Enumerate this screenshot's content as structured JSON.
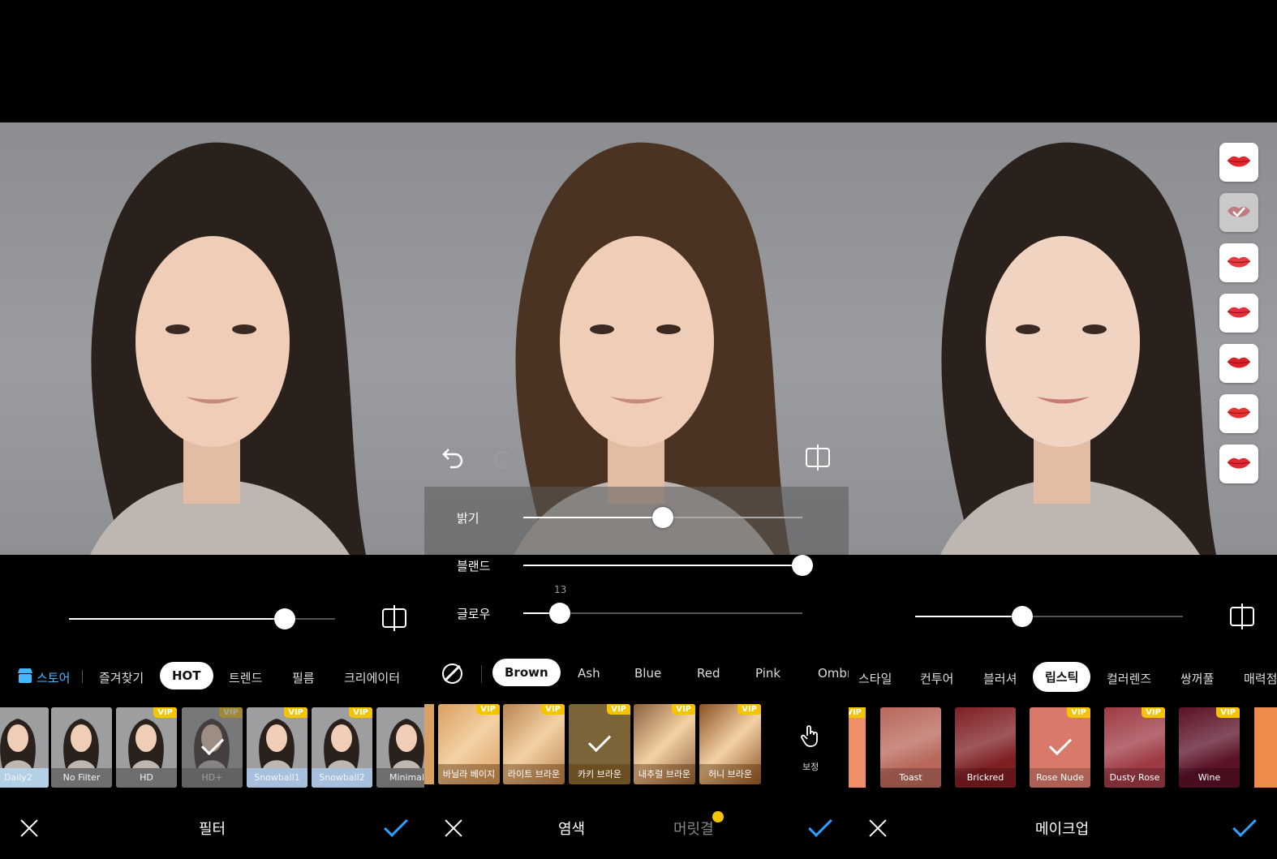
{
  "panels": {
    "filter": {
      "tabs": {
        "store": "스토어",
        "favorites": "즐겨찾기",
        "hot": "HOT",
        "trend": "트렌드",
        "film": "필름",
        "creator": "크리에이터"
      },
      "slider_value": 0.81,
      "items": [
        {
          "label": "Daily2",
          "vip": "",
          "tint": "#b9d7ef"
        },
        {
          "label": "No Filter",
          "vip": "",
          "tint": "#6b6b6b"
        },
        {
          "label": "HD",
          "vip": "VIP",
          "tint": "#6b6b6b"
        },
        {
          "label": "HD+",
          "vip": "VIP",
          "tint": "#6b6b6b",
          "selected": true
        },
        {
          "label": "Snowball1",
          "vip": "VIP",
          "tint": "#a9c6e6"
        },
        {
          "label": "Snowball2",
          "vip": "VIP",
          "tint": "#a9c6e6"
        },
        {
          "label": "Minimal",
          "vip": "",
          "tint": "#6b6b6b"
        }
      ],
      "title": "필터",
      "vip_label": "VIP"
    },
    "haircolor": {
      "sliders": [
        {
          "label": "밝기",
          "value": 0.5
        },
        {
          "label": "블랜드",
          "value": 1.0
        },
        {
          "label": "글로우",
          "value": 0.13,
          "readout": "13"
        }
      ],
      "tabs": [
        "Brown",
        "Ash",
        "Blue",
        "Red",
        "Pink",
        "Ombr"
      ],
      "items": [
        {
          "label": "바닐라 베이지",
          "vip": "VIP",
          "color": "#d9a063"
        },
        {
          "label": "라이트 브라운",
          "vip": "VIP",
          "color": "#b98552"
        },
        {
          "label": "카키 브라운",
          "vip": "VIP",
          "color": "#7a6438",
          "selected": true
        },
        {
          "label": "내추럴 브라운",
          "vip": "VIP",
          "color": "#8c5f3d"
        },
        {
          "label": "허니 브라운",
          "vip": "VIP",
          "color": "#8a5126"
        }
      ],
      "correction_label": "보정",
      "title": "염색",
      "secondary_title": "머릿결"
    },
    "makeup": {
      "tabs": [
        "스타일",
        "컨투어",
        "블러셔",
        "립스틱",
        "컬러렌즈",
        "쌍꺼풀",
        "매력점"
      ],
      "active_tab": "립스틱",
      "slider_value": 0.4,
      "items": [
        {
          "label": "Toast",
          "vip": "",
          "color": "#b8675a"
        },
        {
          "label": "Brickred",
          "vip": "",
          "color": "#7e1f24"
        },
        {
          "label": "Rose Nude",
          "vip": "VIP",
          "color": "#d9796a",
          "selected": true
        },
        {
          "label": "Dusty Rose",
          "vip": "VIP",
          "color": "#9e3a44"
        },
        {
          "label": "Wine",
          "vip": "VIP",
          "color": "#5a1226"
        }
      ],
      "title": "메이크업",
      "lip_colors": [
        "#e2262f",
        "#b0303a",
        "#e63a3e",
        "#e4303a",
        "#d92128",
        "#e5312f",
        "#e2262f"
      ]
    }
  },
  "colors": {
    "accent": "#2aa0ff",
    "vip": "#f5c400"
  }
}
